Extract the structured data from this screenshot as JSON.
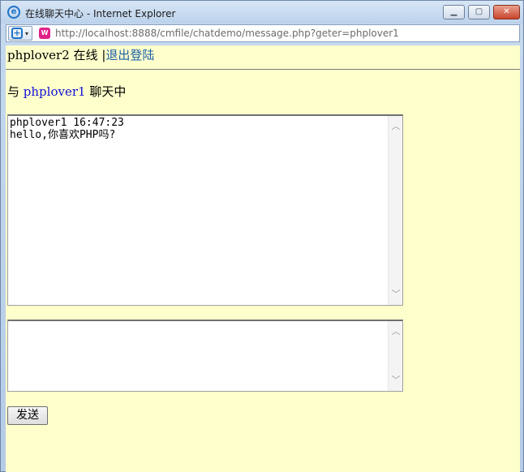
{
  "window": {
    "title": "在线聊天中心 - Internet Explorer",
    "url": "http://localhost:8888/cmfile/chatdemo/message.php?geter=phplover1",
    "controls": {
      "minimize_icon": "minimize-icon",
      "maximize_icon": "maximize-icon",
      "close_icon": "close-icon"
    }
  },
  "header": {
    "user": "phplover2",
    "status": "在线",
    "separator": "|",
    "logout_label": "退出登陆"
  },
  "chat": {
    "prefix": "与",
    "peer": "phplover1",
    "suffix": "聊天中"
  },
  "messages": {
    "text": "phplover1 16:47:23\nhello,你喜欢PHP吗?"
  },
  "input": {
    "value": ""
  },
  "send_label": "发送",
  "colors": {
    "page_background": "#ffffcc",
    "link": "#1a5fa8",
    "peer_name": "#1010d8"
  }
}
